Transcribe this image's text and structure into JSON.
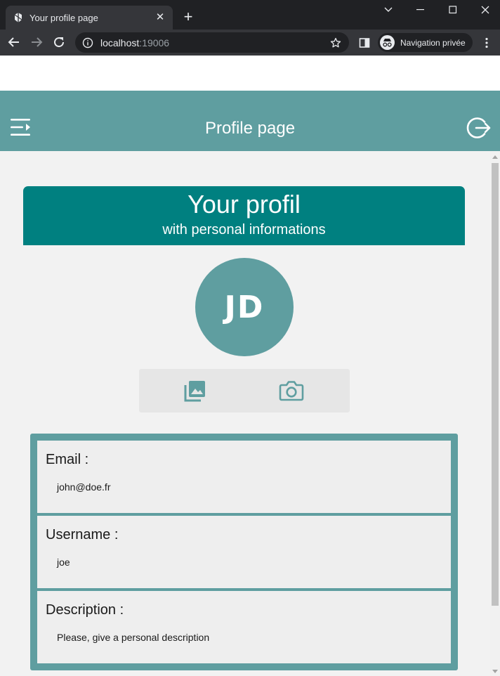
{
  "browser": {
    "tab_title": "Your profile page",
    "tab_close": "✕",
    "new_tab": "+",
    "url_host": "localhost",
    "url_port": ":19006",
    "incognito_label": "Navigation privée"
  },
  "header": {
    "title": "Profile page"
  },
  "card": {
    "title": "Your profil",
    "subtitle": "with personal informations"
  },
  "avatar": {
    "initials": "JD"
  },
  "fields": [
    {
      "label": "Email :",
      "value": "john@doe.fr"
    },
    {
      "label": "Username :",
      "value": "joe"
    },
    {
      "label": "Description :",
      "value": "Please, give a personal description"
    }
  ],
  "colors": {
    "header": "#5f9ea0",
    "card_header": "#008080",
    "content_bg": "#f2f2f2"
  },
  "icons": {
    "menu": "menu-open-icon",
    "logout": "logout-icon",
    "gallery": "image-gallery-icon",
    "camera": "camera-icon"
  }
}
